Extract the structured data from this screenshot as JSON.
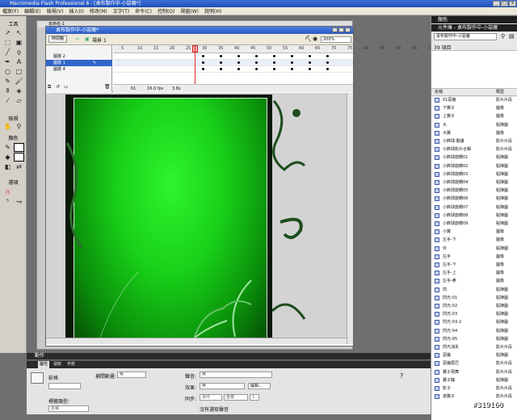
{
  "app": {
    "title": "Macromedia Flash Professional 8 - [桌布製作中-小惡魔*]"
  },
  "menu": [
    "檔案(F)",
    "編輯(E)",
    "檢視(V)",
    "插入(I)",
    "修改(M)",
    "文字(T)",
    "命令(C)",
    "控制(O)",
    "視窗(W)",
    "說明(H)"
  ],
  "tools": {
    "title": "工具",
    "view_label": "檢視",
    "colors_label": "顏色",
    "options_label": "選項"
  },
  "document": {
    "tab": "未命名-1",
    "window_title": "桌布製作中-小惡魔*",
    "back_label": "時間軸",
    "scene": "場景 1",
    "zoom": "200%"
  },
  "timeline": {
    "ruler": [
      "5",
      "10",
      "15",
      "20",
      "25",
      "30",
      "35",
      "40",
      "45",
      "50",
      "55",
      "60",
      "65",
      "70",
      "75",
      "80",
      "85",
      "90",
      "95",
      "100",
      "105"
    ],
    "layers": [
      {
        "name": "圖層 2",
        "selected": false
      },
      {
        "name": "圖層 1",
        "selected": true
      },
      {
        "name": "圖層 4",
        "selected": false
      }
    ],
    "current_frame": "61",
    "fps": "16.0 fps",
    "time": "3.8s"
  },
  "colors": {
    "accent": "#3b6fd8",
    "panel_dark": "#2a2a2a",
    "stage_green": "#18d018"
  },
  "right_panel": {
    "color_title": "顏色",
    "library_title": "元件庫 - 桌布製作中-小惡魔",
    "library_select": "桌布製作中-小惡魔",
    "item_count": "39 項目",
    "col_name": "名稱",
    "col_type": "類型"
  },
  "library": [
    {
      "name": "01惡魔",
      "type": "影片片段"
    },
    {
      "name": "下翼子",
      "type": "圖像"
    },
    {
      "name": "上翼子",
      "type": "圖像"
    },
    {
      "name": "大",
      "type": "點陣圖"
    },
    {
      "name": "大翼",
      "type": "圖像"
    },
    {
      "name": "小飾球-動畫",
      "type": "影片片段"
    },
    {
      "name": "小飾球影片合輯",
      "type": "影片片段"
    },
    {
      "name": "小飾球旋轉01",
      "type": "點陣圖"
    },
    {
      "name": "小飾球旋轉02",
      "type": "點陣圖"
    },
    {
      "name": "小飾球旋轉03",
      "type": "點陣圖"
    },
    {
      "name": "小飾球旋轉04",
      "type": "點陣圖"
    },
    {
      "name": "小飾球旋轉05",
      "type": "點陣圖"
    },
    {
      "name": "小飾球旋轉06",
      "type": "點陣圖"
    },
    {
      "name": "小飾球旋轉07",
      "type": "點陣圖"
    },
    {
      "name": "小飾球旋轉08",
      "type": "點陣圖"
    },
    {
      "name": "小飾球旋轉09",
      "type": "點陣圖"
    },
    {
      "name": "小翼",
      "type": "圖像"
    },
    {
      "name": "左手-下",
      "type": "圖像"
    },
    {
      "name": "外",
      "type": "點陣圖"
    },
    {
      "name": "左手",
      "type": "圖像"
    },
    {
      "name": "左手-下",
      "type": "圖像"
    },
    {
      "name": "左手-上",
      "type": "圖像"
    },
    {
      "name": "左手-拳",
      "type": "圖像"
    },
    {
      "name": "閃",
      "type": "點陣圖"
    },
    {
      "name": "閃光-01",
      "type": "點陣圖"
    },
    {
      "name": "閃光-02",
      "type": "點陣圖"
    },
    {
      "name": "閃光-03",
      "type": "點陣圖"
    },
    {
      "name": "閃光-03-2",
      "type": "點陣圖"
    },
    {
      "name": "閃光-04",
      "type": "點陣圖"
    },
    {
      "name": "閃光-05",
      "type": "點陣圖"
    },
    {
      "name": "閃光消失",
      "type": "影片片段"
    },
    {
      "name": "惡魔",
      "type": "點陣圖"
    },
    {
      "name": "惡魔尾巴",
      "type": "影片片段"
    },
    {
      "name": "翼子飛舞",
      "type": "影片片段"
    },
    {
      "name": "翼子醜",
      "type": "點陣圖"
    },
    {
      "name": "影子",
      "type": "影片片段"
    },
    {
      "name": "遮翼子",
      "type": "影片片段"
    }
  ],
  "bottom": {
    "actions_title": "動作",
    "tabs": [
      "屬性",
      "濾鏡",
      "參數"
    ],
    "doc_label": "影格",
    "tween_label": "補間動畫:",
    "tween_value": "無",
    "sound_label": "聲音:",
    "sound_value": "無",
    "effect_label": "效果:",
    "effect_value": "無",
    "edit_label": "編輯...",
    "sync_label": "同步:",
    "sync_value": "事件",
    "repeat_value": "重複",
    "repeat_count": "1",
    "label_type_label": "標籤類型:",
    "label_type_value": "名稱",
    "no_sound": "沒有選取聲音"
  },
  "watermark": "#319160"
}
